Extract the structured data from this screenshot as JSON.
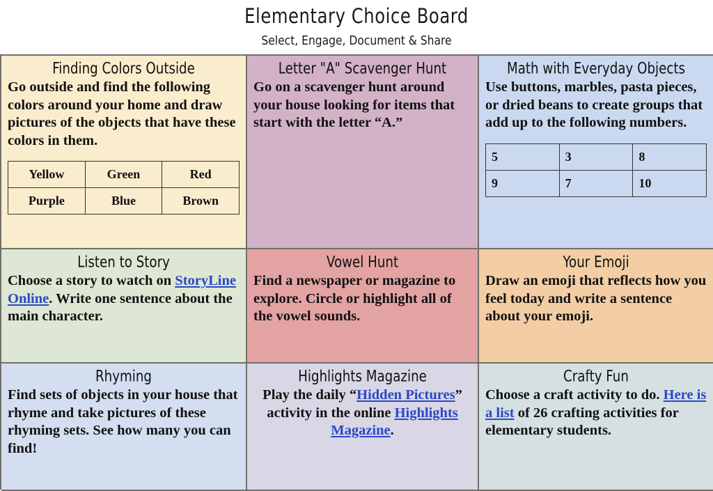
{
  "header": {
    "title": "Elementary Choice Board",
    "subtitle": "Select, Engage, Document & Share"
  },
  "colors": {
    "border": "#6f6f6a",
    "link": "#2b49c4",
    "text": "#111111",
    "cell_cream": "#faedcd",
    "cell_mauve": "#d3b2c7",
    "cell_blue": "#cbd9f0",
    "cell_green": "#dde7d3",
    "cell_salmon": "#e4a3a3",
    "cell_peach": "#f3cda4",
    "cell_lightblue": "#d3dff0",
    "cell_lavender": "#d9d6e6",
    "cell_slate": "#d6e0e2"
  },
  "cells": [
    {
      "id": "finding-colors-outside",
      "title": "Finding Colors Outside",
      "body": "Go outside and find the following colors around your home and draw pictures of the objects that have these colors in them.",
      "align": "left",
      "table": {
        "align": "center",
        "rows": [
          [
            "Yellow",
            "Green",
            "Red"
          ],
          [
            "Purple",
            "Blue",
            "Brown"
          ]
        ]
      }
    },
    {
      "id": "letter-a-scavenger-hunt",
      "title": "Letter \"A\" Scavenger Hunt",
      "body": "Go on a scavenger hunt around your house looking for items that start with the letter “A.”",
      "align": "left",
      "table": null
    },
    {
      "id": "math-with-everyday-objects",
      "title": "Math with Everyday Objects",
      "body": "Use buttons, marbles, pasta pieces, or dried beans to create groups that add up to the following numbers.",
      "align": "left",
      "table": {
        "align": "left",
        "rows": [
          [
            "5",
            "3",
            "8"
          ],
          [
            "9",
            "7",
            "10"
          ]
        ]
      }
    },
    {
      "id": "listen-to-story",
      "title": "Listen to Story",
      "body_parts": [
        {
          "type": "text",
          "value": "Choose a story to watch on "
        },
        {
          "type": "link",
          "value": "StoryLine Online"
        },
        {
          "type": "text",
          "value": ". Write one sentence about the main character."
        }
      ],
      "align": "left",
      "table": null
    },
    {
      "id": "vowel-hunt",
      "title": "Vowel Hunt",
      "body": "Find a newspaper or magazine to explore. Circle or highlight all of the vowel sounds.",
      "align": "left",
      "table": null
    },
    {
      "id": "your-emoji",
      "title": "Your Emoji",
      "body": "Draw an emoji that reflects how you feel today and write a sentence about your emoji.",
      "align": "left",
      "table": null
    },
    {
      "id": "rhyming",
      "title": "Rhyming",
      "body": "Find sets of objects in your house that rhyme and take pictures of these rhyming sets. See how many you can find!",
      "align": "left",
      "table": null
    },
    {
      "id": "highlights-magazine",
      "title": "Highlights Magazine",
      "body_parts": [
        {
          "type": "text",
          "value": "Play the daily “"
        },
        {
          "type": "link",
          "value": "Hidden Pictures"
        },
        {
          "type": "text",
          "value": "” activity in the online "
        },
        {
          "type": "link",
          "value": "Highlights Magazine"
        },
        {
          "type": "text",
          "value": "."
        }
      ],
      "align": "center",
      "table": null
    },
    {
      "id": "crafty-fun",
      "title": "Crafty Fun",
      "body_parts": [
        {
          "type": "text",
          "value": "Choose a craft activity to do. "
        },
        {
          "type": "link",
          "value": "Here is a list"
        },
        {
          "type": "text",
          "value": " of 26 crafting activities for elementary students."
        }
      ],
      "align": "left",
      "table": null
    }
  ]
}
